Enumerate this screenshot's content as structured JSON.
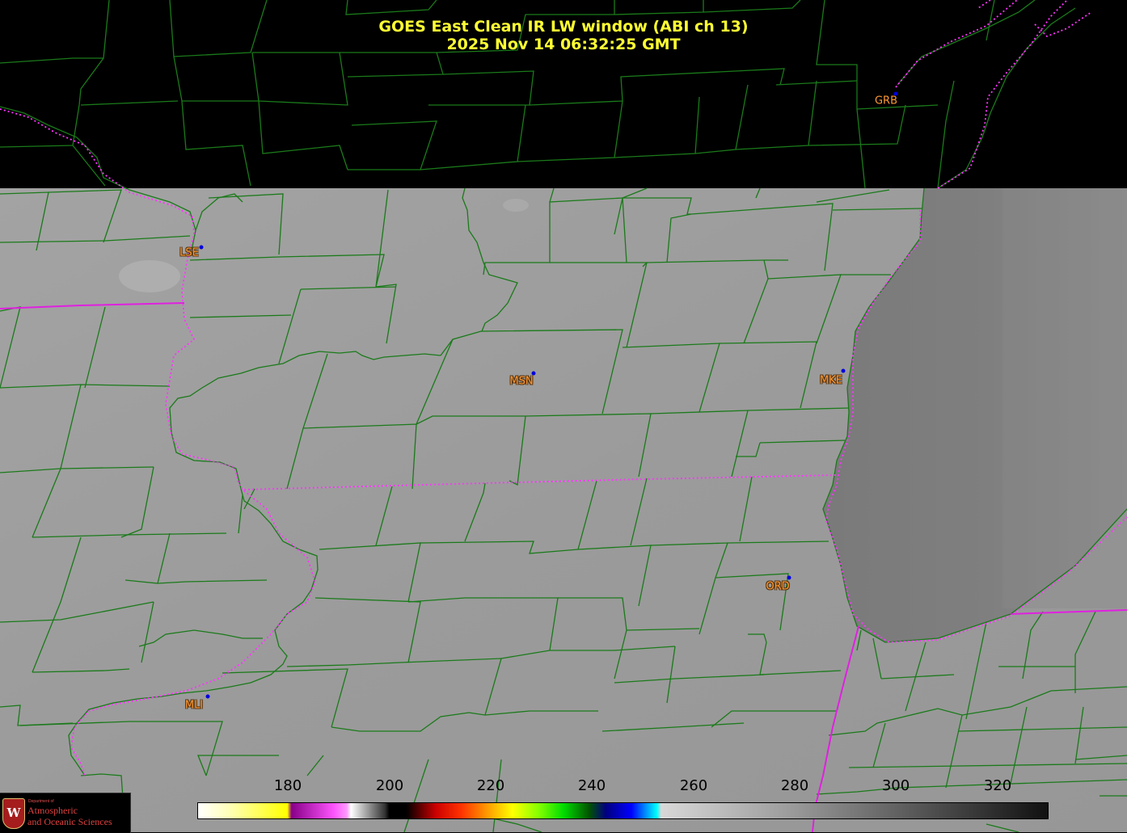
{
  "header": {
    "title_line1": "GOES East Clean IR LW window (ABI ch 13)",
    "title_line2": "2025 Nov 14  06:32:25 GMT"
  },
  "stations": [
    {
      "id": "grb",
      "label": "GRB",
      "in_dark": true
    },
    {
      "id": "lse",
      "label": "LSE",
      "in_dark": false
    },
    {
      "id": "msn",
      "label": "MSN",
      "in_dark": false
    },
    {
      "id": "mke",
      "label": "MKE",
      "in_dark": false
    },
    {
      "id": "ord",
      "label": "ORD",
      "in_dark": false
    },
    {
      "id": "mli",
      "label": "MLI",
      "in_dark": false
    }
  ],
  "colorbar": {
    "ticks": [
      "180",
      "200",
      "220",
      "240",
      "260",
      "280",
      "300",
      "320"
    ]
  },
  "logo": {
    "crest_letter": "W",
    "department": "Department of",
    "line1": "Atmospheric",
    "line2": "and Oceanic Sciences"
  },
  "colors": {
    "title": "#ffff33",
    "county_lines": "#1a7a1a",
    "state_lines": "#ff33ff",
    "station_label": "#ff9933",
    "station_dot": "#0000dd",
    "land_gray": "#9c9c9c",
    "lake_gray": "#7d7d7d",
    "no_data": "#000000"
  }
}
